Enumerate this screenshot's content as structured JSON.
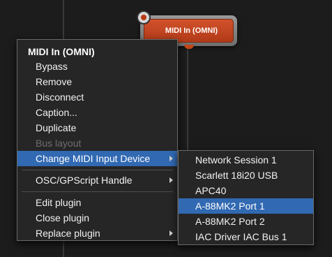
{
  "plugin": {
    "label": "MIDI In (OMNI)"
  },
  "context_menu": {
    "title": "MIDI In (OMNI)",
    "items": [
      {
        "label": "Bypass"
      },
      {
        "label": "Remove"
      },
      {
        "label": "Disconnect"
      },
      {
        "label": "Caption..."
      },
      {
        "label": "Duplicate"
      },
      {
        "label": "Bus layout",
        "disabled": true
      },
      {
        "label": "Change MIDI Input Device",
        "submenu": true,
        "highlighted": true
      },
      {
        "label": "OSC/GPScript Handle",
        "submenu": true
      },
      {
        "label": "Edit plugin"
      },
      {
        "label": "Close plugin"
      },
      {
        "label": "Replace plugin",
        "submenu": true
      }
    ]
  },
  "submenu": {
    "items": [
      {
        "label": "Network Session 1"
      },
      {
        "label": "Scarlett 18i20 USB"
      },
      {
        "label": "APC40"
      },
      {
        "label": "A-88MK2 Port 1",
        "highlighted": true
      },
      {
        "label": "A-88MK2 Port 2"
      },
      {
        "label": "IAC Driver IAC Bus 1"
      }
    ]
  },
  "colors": {
    "highlight": "#3169b2",
    "plugin": "#c2461f",
    "background": "#1c1c1c"
  }
}
